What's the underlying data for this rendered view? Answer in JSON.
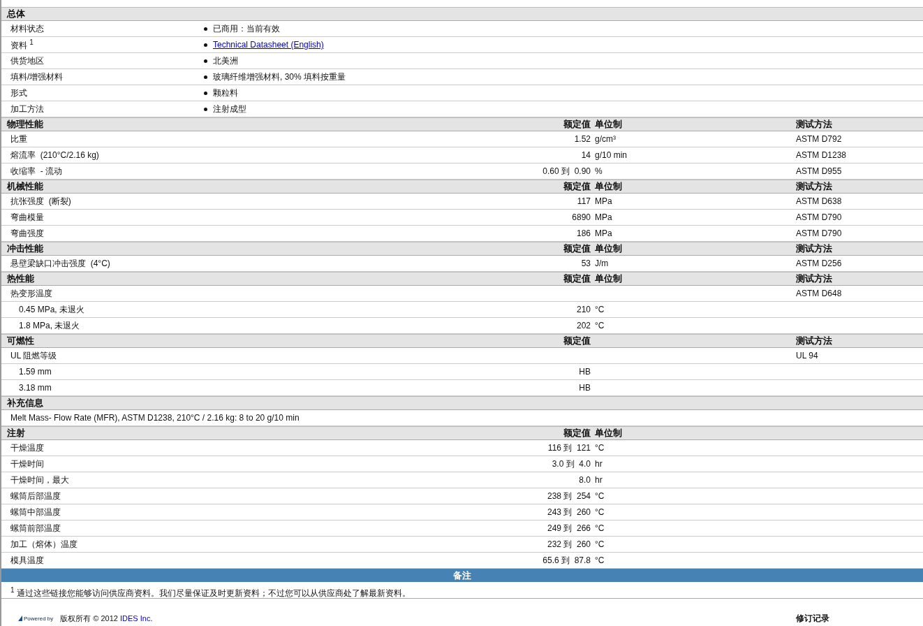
{
  "sections": [
    {
      "title": "总体",
      "kind": "bullets",
      "rows": [
        {
          "label": "材料状态",
          "value": "已商用：当前有效"
        },
        {
          "label": "资料 $^{1}$",
          "value": "Technical Datasheet (English)",
          "link": true
        },
        {
          "label": "供货地区",
          "value": "北美洲"
        },
        {
          "label": "填料/增强材料",
          "value": "玻璃纤维增强材料, 30% 填料按重量"
        },
        {
          "label": "形式",
          "value": "颗粒料"
        },
        {
          "label": "加工方法",
          "value": "注射成型"
        }
      ]
    },
    {
      "title": "物理性能",
      "kind": "props",
      "headers": {
        "value": "额定值",
        "unit": "单位制",
        "test": "测试方法"
      },
      "rows": [
        {
          "label": "比重",
          "value": "1.52",
          "unit": "g/cm³",
          "test": "ASTM D792"
        },
        {
          "label": "熔流率  (210°C/2.16 kg)",
          "value": "14",
          "unit": "g/10 min",
          "test": "ASTM D1238"
        },
        {
          "label": "收缩率  - 流动",
          "value": "0.60 到  0.90",
          "unit": "%",
          "test": "ASTM D955"
        }
      ]
    },
    {
      "title": "机械性能",
      "kind": "props",
      "headers": {
        "value": "额定值",
        "unit": "单位制",
        "test": "测试方法"
      },
      "rows": [
        {
          "label": "抗张强度  (断裂)",
          "value": "117",
          "unit": "MPa",
          "test": "ASTM D638"
        },
        {
          "label": "弯曲模量",
          "value": "6890",
          "unit": "MPa",
          "test": "ASTM D790"
        },
        {
          "label": "弯曲强度",
          "value": "186",
          "unit": "MPa",
          "test": "ASTM D790"
        }
      ]
    },
    {
      "title": "冲击性能",
      "kind": "props",
      "headers": {
        "value": "额定值",
        "unit": "单位制",
        "test": "测试方法"
      },
      "rows": [
        {
          "label": "悬壁梁缺口冲击强度  (4°C)",
          "value": "53",
          "unit": "J/m",
          "test": "ASTM D256"
        }
      ]
    },
    {
      "title": "热性能",
      "kind": "props",
      "headers": {
        "value": "额定值",
        "unit": "单位制",
        "test": "测试方法"
      },
      "rows": [
        {
          "label": "热变形温度",
          "test": "ASTM D648",
          "children": [
            {
              "label": "0.45 MPa, 未退火",
              "value": "210",
              "unit": "°C"
            },
            {
              "label": "1.8 MPa, 未退火",
              "value": "202",
              "unit": "°C"
            }
          ]
        }
      ]
    },
    {
      "title": "可燃性",
      "kind": "props",
      "headers": {
        "value": "额定值",
        "test": "测试方法"
      },
      "rows": [
        {
          "label": "UL 阻燃等级",
          "test": "UL 94",
          "children": [
            {
              "label": "1.59 mm",
              "value": "HB"
            },
            {
              "label": "3.18 mm",
              "value": "HB"
            }
          ]
        }
      ]
    },
    {
      "title": "补充信息",
      "kind": "note",
      "text": "Melt Mass- Flow Rate (MFR), ASTM D1238, 210°C / 2.16 kg: 8 to 20 g/10 min"
    },
    {
      "title": "注射",
      "kind": "props",
      "headers": {
        "value": "额定值",
        "unit": "单位制"
      },
      "rows": [
        {
          "label": "干燥温度",
          "value": "116 到  121",
          "unit": "°C"
        },
        {
          "label": "干燥时间",
          "value": "3.0 到  4.0",
          "unit": "hr"
        },
        {
          "label": "干燥时间，最大",
          "value": "8.0",
          "unit": "hr"
        },
        {
          "label": "螺筒后部温度",
          "value": "238 到  254",
          "unit": "°C"
        },
        {
          "label": "螺筒中部温度",
          "value": "243 到  260",
          "unit": "°C"
        },
        {
          "label": "螺筒前部温度",
          "value": "249 到  266",
          "unit": "°C"
        },
        {
          "label": "加工（熔体）温度",
          "value": "232 到  260",
          "unit": "°C"
        },
        {
          "label": "模具温度",
          "value": "65.6 到  87.8",
          "unit": "°C"
        }
      ]
    }
  ],
  "notes": {
    "title": "备注",
    "footnote": "$^{1}$ 通过这些链接您能够访问供应商资料。我们尽量保证及时更新资料；不过您可以从供应商处了解最新资料。"
  },
  "footer": {
    "powered": "Powered by",
    "copyright": "版权所有 © 2012",
    "company": "IDES Inc.",
    "history": "修订记录"
  }
}
